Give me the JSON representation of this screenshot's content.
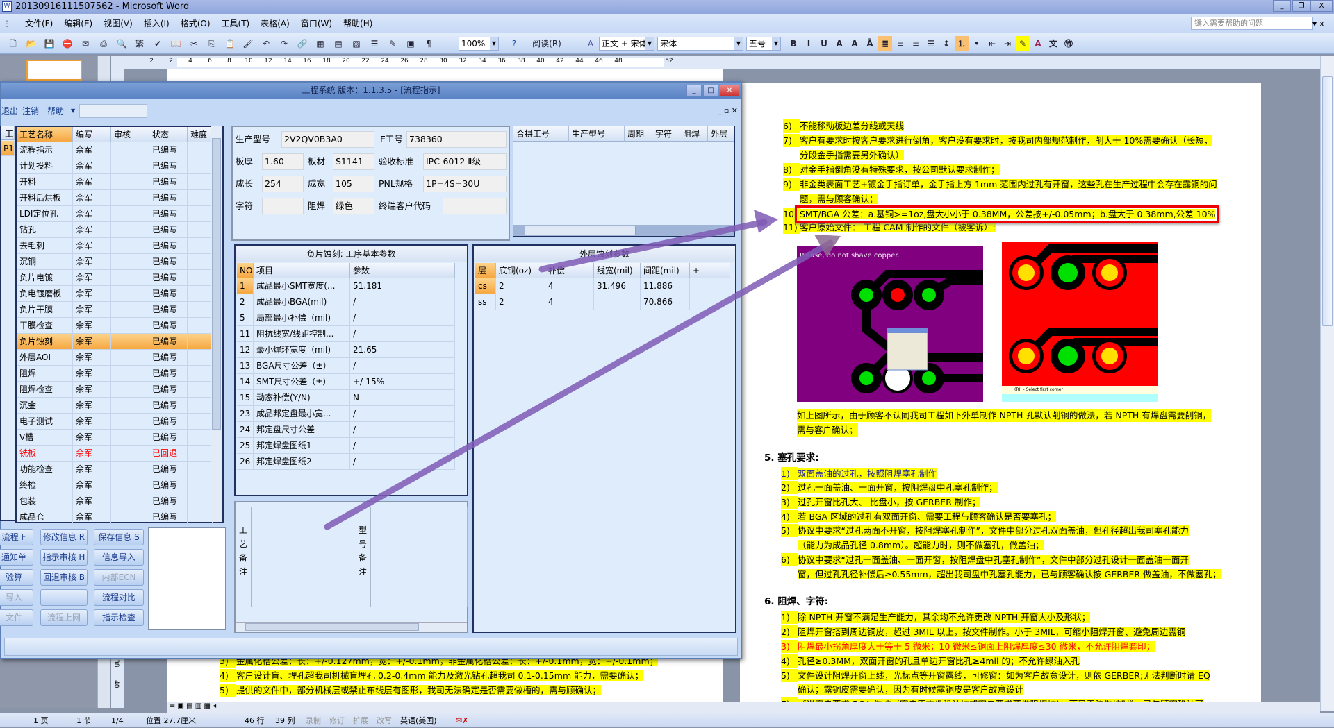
{
  "word": {
    "title": "20130916111507562 - Microsoft Word",
    "title_icon": "W",
    "menu": [
      "文件(F)",
      "编辑(E)",
      "视图(V)",
      "插入(I)",
      "格式(O)",
      "工具(T)",
      "表格(A)",
      "窗口(W)",
      "帮助(H)"
    ],
    "help_placeholder": "键入需要帮助的问题",
    "toolbar": {
      "zoom": "100%",
      "read_label": "阅读(R)",
      "style": "正文 + 宋体",
      "font": "宋体",
      "size": "五号",
      "trad_label": "繁"
    },
    "ruler_numbers": [
      "2",
      "2",
      "4",
      "6",
      "8",
      "10",
      "12",
      "14",
      "16",
      "18",
      "20",
      "22",
      "24",
      "26",
      "28",
      "30",
      "32",
      "34",
      "36",
      "38",
      "40",
      "42",
      "44",
      "46",
      "48",
      "52"
    ],
    "vruler_numbers": [
      "38",
      "40"
    ],
    "document": {
      "right_page": [
        {
          "num": "6)",
          "text": "不能移动板边差分线或天线"
        },
        {
          "num": "7)",
          "text": "客户有要求时按客户要求进行倒角，客户没有要求时，按我司内部规范制作，削大于 10%需要确认（长短，"
        },
        {
          "num": "",
          "text": "分段金手指需要另外确认）"
        },
        {
          "num": "8)",
          "text": "对金手指倒角没有特殊要求，按公司默认要求制作；"
        },
        {
          "num": "9)",
          "text": "非金类表面工艺+镀金手指订单，金手指上方 1mm 范围内过孔有开窗，这些孔在生产过程中会存在露铜的问"
        },
        {
          "num": "",
          "text": "题，需与顾客确认；"
        },
        {
          "num": "10)",
          "text": "SMT/BGA 公差：a.基铜>=1oz,盘大小小于 0.38MM，公差按+/-0.05mm；b.盘大于 0.38mm,公差 10%"
        },
        {
          "num": "11)",
          "text": "客户原始文件：                    工程 CAM 制作的文件（被客诉）:"
        }
      ],
      "image_caption": "Please, do not shave copper.",
      "image2_status": "(RI) - Select first corner",
      "after_images": [
        "如上图所示，由于顾客不认同我司工程如下外单制作 NPTH 孔默认削铜的做法，若 NPTH 有焊盘需要削铜，",
        "需与客户确认；"
      ],
      "section5": {
        "title": "5.   塞孔要求:",
        "items": [
          {
            "num": "1)",
            "text": "双面盖油的过孔，按照阻焊塞孔制作",
            "style": "blue"
          },
          {
            "num": "2)",
            "text": "过孔一面盖油、一面开窗，按阻焊盘中孔塞孔制作；"
          },
          {
            "num": "3)",
            "text": "过孔开窗比孔大、 比盘小，按 GERBER 制作；"
          },
          {
            "num": "4)",
            "text": "若 BGA 区域的过孔有双面开窗、需要工程与顾客确认是否要塞孔；"
          },
          {
            "num": "5)",
            "text": "协议中要求“过孔两面不开窗，按阻焊塞孔制作”，文件中部分过孔双面盖油，但孔径超出我司塞孔能力"
          },
          {
            "num": "",
            "text": "（能力为成品孔径 0.8mm）。超能力时，则不做塞孔，做盖油；"
          },
          {
            "num": "6)",
            "text": "协议中要求“过孔一面盖油、一面开窗，按阻焊盘中孔塞孔制作”，文件中部分过孔设计一面盖油一面开"
          },
          {
            "num": "",
            "text": "窗，但过孔孔径补偿后≥0.55mm，超出我司盘中孔塞孔能力，已与顾客确认按 GERBER 做盖油，不做塞孔；"
          }
        ]
      },
      "section6": {
        "title": "6.   阻焊、字符:",
        "items": [
          {
            "num": "1)",
            "text": "除 NPTH 开窗不满足生产能力，其余均不允许更改 NPTH 开窗大小及形状；"
          },
          {
            "num": "2)",
            "text": "阻焊开窗搭到周边铜皮，超过 3MIL 以上，按文件制作。小于 3MIL，可缩小阻焊开窗、避免周边露铜"
          },
          {
            "num": "3)",
            "text": "阻焊最小拐角厚度大于等于 5 微米；10 微米≤铜面上阻焊厚度≤30 微米，不允许阻焊套印；",
            "style": "red"
          },
          {
            "num": "4)",
            "text": "孔径≥0.3MM，双面开窗的孔且单边开窗比孔≥4mil 的；不允许绿油入孔"
          },
          {
            "num": "5)",
            "text": "文件设计阻焊开窗上线，光标点等开窗露线，可修窗：如为客户故意设计，则依 GERBER;无法判断时请 EQ"
          },
          {
            "num": "",
            "text": "确认；露铜皮需要确认，因为有时候露铜皮是客户故意设计"
          },
          {
            "num": "7)",
            "text": "《当客户要求 BGA 做坑（客户原文件设计坑或客户要求要做阻焊坑），而又无法做坑时》，已与顾客确认可"
          }
        ]
      },
      "left_page": [
        {
          "num": "3)",
          "text": "金属化槽公差：长：+/-0.127mm，宽：+/-0.1mm，非金属化槽公差：长：+/-0.1mm，宽：+/-0.1mm；"
        },
        {
          "num": "4)",
          "text": "客户设计盲、埋孔超我司机械盲埋孔 0.2-0.4mm 能力及激光钻孔超我司 0.1-0.15mm 能力，需要确认；"
        },
        {
          "num": "5)",
          "text": "提供的文件中，部分机械层或禁止布线层有图形，我司无法确定是否需要做槽的，需与顾确认；"
        }
      ]
    },
    "status": {
      "page": "1 页",
      "section": "1 节",
      "pages": "1/4",
      "position": "位置 27.7厘米",
      "line": "46 行",
      "col": "39 列",
      "rec": "录制",
      "trk": "修订",
      "ext": "扩展",
      "ovr": "改写",
      "lang": "英语(美国)"
    }
  },
  "app": {
    "title": "工程系统   版本：1.1.3.5 - [流程指示]",
    "menu": [
      "退出",
      "注销",
      "帮助"
    ],
    "left_stub": {
      "header": "工",
      "row": "P1"
    },
    "process_grid": {
      "columns": [
        "工艺名称",
        "编写",
        "审核",
        "状态",
        "难度"
      ],
      "rows": [
        [
          "流程指示",
          "佘军",
          "",
          "已编写",
          ""
        ],
        [
          "计划投料",
          "佘军",
          "",
          "已编写",
          ""
        ],
        [
          "开料",
          "佘军",
          "",
          "已编写",
          ""
        ],
        [
          "开料后烘板",
          "佘军",
          "",
          "已编写",
          ""
        ],
        [
          "LDI定位孔",
          "佘军",
          "",
          "已编写",
          ""
        ],
        [
          "钻孔",
          "佘军",
          "",
          "已编写",
          ""
        ],
        [
          "去毛刺",
          "佘军",
          "",
          "已编写",
          ""
        ],
        [
          "沉铜",
          "佘军",
          "",
          "已编写",
          ""
        ],
        [
          "负片电镀",
          "佘军",
          "",
          "已编写",
          ""
        ],
        [
          "负电镀磨板",
          "佘军",
          "",
          "已编写",
          ""
        ],
        [
          "负片干膜",
          "佘军",
          "",
          "已编写",
          ""
        ],
        [
          "干膜检查",
          "佘军",
          "",
          "已编写",
          ""
        ],
        [
          "负片蚀刻",
          "佘军",
          "",
          "已编写",
          ""
        ],
        [
          "外层AOI",
          "佘军",
          "",
          "已编写",
          ""
        ],
        [
          "阻焊",
          "佘军",
          "",
          "已编写",
          ""
        ],
        [
          "阻焊检查",
          "佘军",
          "",
          "已编写",
          ""
        ],
        [
          "沉金",
          "佘军",
          "",
          "已编写",
          ""
        ],
        [
          "电子测试",
          "佘军",
          "",
          "已编写",
          ""
        ],
        [
          "V槽",
          "佘军",
          "",
          "已编写",
          ""
        ],
        [
          "铣板",
          "佘军",
          "",
          "已回退",
          ""
        ],
        [
          "功能检查",
          "佘军",
          "",
          "已编写",
          ""
        ],
        [
          "终检",
          "佘军",
          "",
          "已编写",
          ""
        ],
        [
          "包装",
          "佘军",
          "",
          "已编写",
          ""
        ],
        [
          "成品仓",
          "佘军",
          "",
          "已编写",
          ""
        ]
      ],
      "selected_row": 12,
      "returned_row": 19
    },
    "buttons": [
      [
        "流程 F",
        "修改信息 R",
        "保存信息 S"
      ],
      [
        "通知单",
        "指示审核 H",
        "信息导入"
      ],
      [
        "验算",
        "回退审核 B",
        "内部ECN"
      ],
      [
        "导入",
        "",
        "流程对比"
      ],
      [
        "文件",
        "流程上网",
        "指示检查"
      ]
    ],
    "disabled_buttons": [
      "内部ECN",
      "导入",
      "文件",
      "流程上网"
    ],
    "info": {
      "model_label": "生产型号",
      "model": "2V2QV0B3A0",
      "eno_label": "E工号",
      "eno": "738360",
      "thick_label": "板厚",
      "thick": "1.60",
      "mat_label": "板材",
      "mat": "S1141",
      "std_label": "验收标准",
      "std": "IPC-6012 Ⅱ级",
      "len_label": "成长",
      "len": "254",
      "wid_label": "成宽",
      "wid": "105",
      "pnl_label": "PNL规格",
      "pnl": "1P=4S=30U",
      "char_label": "字符",
      "char": "",
      "mask_label": "阻焊",
      "mask": "绿色",
      "cust_label": "终端客户代码",
      "cust": ""
    },
    "merge_grid": {
      "columns": [
        "合拼工号",
        "生产型号",
        "周期",
        "字符",
        "阻焊",
        "外层"
      ]
    },
    "params": {
      "title": "负片蚀刻: 工序基本参数",
      "columns": [
        "NO",
        "项目",
        "参数"
      ],
      "rows": [
        [
          "1",
          "成品最小SMT宽度(...",
          "51.181"
        ],
        [
          "2",
          "成品最小BGA(mil)",
          "/"
        ],
        [
          "5",
          "局部最小补偿（mil)",
          "/"
        ],
        [
          "11",
          "阻抗线宽/线距控制...",
          "/"
        ],
        [
          "12",
          "最小焊环宽度（mil)",
          "21.65"
        ],
        [
          "13",
          "BGA尺寸公差（±）",
          "/"
        ],
        [
          "14",
          "SMT尺寸公差（±）",
          "+/-15%"
        ],
        [
          "15",
          "动态补偿(Y/N)",
          "N"
        ],
        [
          "23",
          "成品邦定盘最小宽...",
          "/"
        ],
        [
          "24",
          "邦定盘尺寸公差",
          "/"
        ],
        [
          "25",
          "邦定焊盘图纸1",
          "/"
        ],
        [
          "26",
          "邦定焊盘图纸2",
          "/"
        ]
      ]
    },
    "outer": {
      "title": "外层蚀刻参数",
      "columns": [
        "层",
        "底铜(oz)",
        "补偿",
        "线宽(mil)",
        "间距(mil)",
        "+",
        "-"
      ],
      "rows": [
        [
          "cs",
          "2",
          "4",
          "31.496",
          "11.886",
          "",
          ""
        ],
        [
          "ss",
          "2",
          "4",
          "",
          "70.866",
          "",
          ""
        ]
      ]
    },
    "remarks": {
      "process_label": "工艺备注",
      "model_label": "型号备注"
    }
  },
  "colors": {
    "highlight": "#ffff00",
    "selection": "#f6a741",
    "annotation_arrow": "#7f5bb5",
    "callout_box": "#e00000",
    "returned": "#ff0000"
  }
}
